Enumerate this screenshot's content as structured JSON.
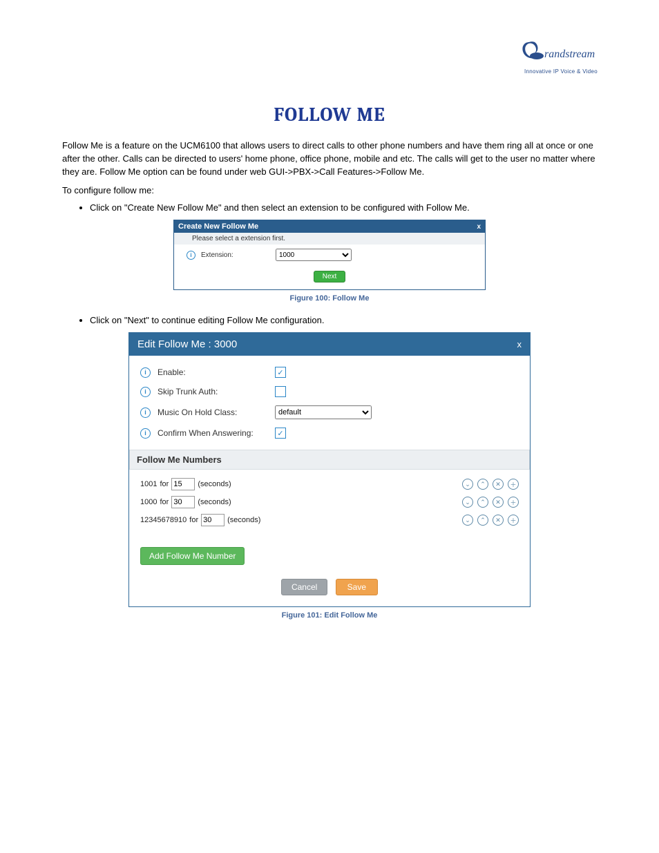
{
  "logo": {
    "brand_text": "randstream",
    "subtext": "Innovative IP Voice & Video"
  },
  "page": {
    "title": "FOLLOW ME",
    "intro1": "Follow Me is a feature on the UCM6100 that allows users to direct calls to other phone numbers and have them ring all at once or one after the other. Calls can be directed to users' home phone, office phone, mobile and etc. The calls will get to the user no matter where they are. Follow Me option can be found under web GUI->PBX->Call Features->Follow Me.",
    "intro2": "To configure follow me:",
    "bullet1": "Click on \"Create New Follow Me\" and then select an extension to be configured with Follow Me.",
    "bullet2": "Click on \"Next\" to continue editing Follow Me configuration.",
    "fig1_caption": "Figure 100: Follow Me",
    "fig2_caption": "Figure 101: Edit Follow Me"
  },
  "dlg1": {
    "title": "Create New Follow Me",
    "close": "x",
    "subheader": "Please select a extension first.",
    "ext_label": "Extension:",
    "ext_value": "1000",
    "next_btn": "Next"
  },
  "dlg2": {
    "title": "Edit Follow Me : 3000",
    "close": "x",
    "enable_label": "Enable:",
    "enable_checked": true,
    "skip_label": "Skip Trunk Auth:",
    "skip_checked": false,
    "moh_label": "Music On Hold Class:",
    "moh_value": "default",
    "confirm_label": "Confirm When Answering:",
    "confirm_checked": true,
    "section_title": "Follow Me Numbers",
    "items": [
      {
        "number": "1001",
        "for": "for",
        "seconds": "15",
        "unit": "(seconds)"
      },
      {
        "number": "1000",
        "for": "for",
        "seconds": "30",
        "unit": "(seconds)"
      },
      {
        "number": "12345678910",
        "for": "for",
        "seconds": "30",
        "unit": "(seconds)"
      }
    ],
    "add_btn": "Add Follow Me Number",
    "cancel_btn": "Cancel",
    "save_btn": "Save"
  }
}
